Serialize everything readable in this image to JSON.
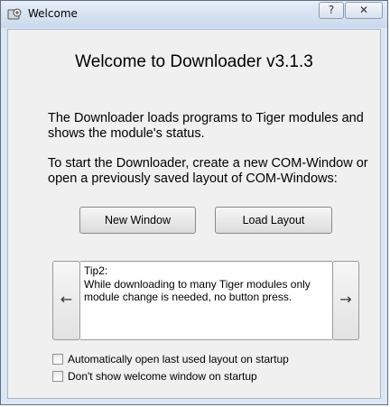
{
  "window": {
    "title": "Welcome",
    "help_label": "?",
    "close_label": "✕"
  },
  "main": {
    "heading": "Welcome to Downloader v3.1.3",
    "paragraph1": "The Downloader loads programs to Tiger modules and shows the module's status.",
    "paragraph2": "To start the Downloader, create a new COM-Window or open a previously saved layout of COM-Windows:"
  },
  "buttons": {
    "new_window": "New Window",
    "load_layout": "Load Layout"
  },
  "tip": {
    "prev_arrow": "←",
    "next_arrow": "→",
    "lines": [
      "Tip2:",
      "While downloading to many Tiger modules only",
      "module change is needed, no button press."
    ]
  },
  "options": {
    "auto_open": {
      "label": "Automatically open last used layout on startup",
      "checked": false
    },
    "dont_show": {
      "label": "Don't show welcome window on startup",
      "checked": false
    }
  }
}
